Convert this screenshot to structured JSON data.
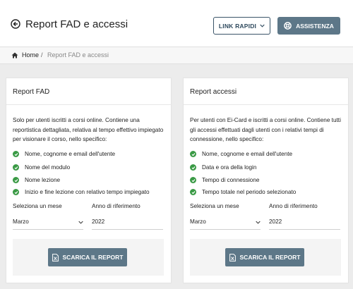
{
  "header": {
    "title": "Report FAD e accessi",
    "links_label": "LINK RAPIDI",
    "help_label": "ASSISTENZA"
  },
  "breadcrumb": {
    "home": "Home",
    "separator": "/",
    "current": "Report FAD e accessi"
  },
  "cards": [
    {
      "title": "Report FAD",
      "description": "Solo per utenti iscritti a corsi online. Contiene una reportistica dettagliata, relativa al tempo effettivo impiegato per visionare il corso, nello specifico:",
      "features": [
        "Nome, cognome e email dell'utente",
        "Nome del modulo",
        "Nome lezione",
        "Inizio e fine lezione con relativo tempo impiegato"
      ],
      "month_label": "Seleziona un mese",
      "year_label": "Anno di riferimento",
      "month_value": "Marzo",
      "year_value": "2022",
      "download_label": "SCARICA IL REPORT"
    },
    {
      "title": "Report accessi",
      "description": "Per utenti con Ei-Card e iscritti a corsi online. Contiene tutti gli accessi effettuati dagli utenti con i relativi tempi di connessione, nello specifico:",
      "features": [
        "Nome, cognome e email dell'utente",
        "Data e ora della login",
        "Tempo di connessione",
        "Tempo totale nel periodo selezionato"
      ],
      "month_label": "Seleziona un mese",
      "year_label": "Anno di riferimento",
      "month_value": "Marzo",
      "year_value": "2022",
      "download_label": "SCARICA IL REPORT"
    }
  ],
  "colors": {
    "accent": "#5d7788",
    "outline": "#3a5468",
    "check": "#3a9a45",
    "background": "#ececec"
  },
  "icons": {
    "back": "arrow-left-circle-icon",
    "chevron": "chevron-down-icon",
    "help": "lifebuoy-icon",
    "home": "home-icon",
    "check": "check-circle-icon",
    "file": "excel-file-icon"
  }
}
